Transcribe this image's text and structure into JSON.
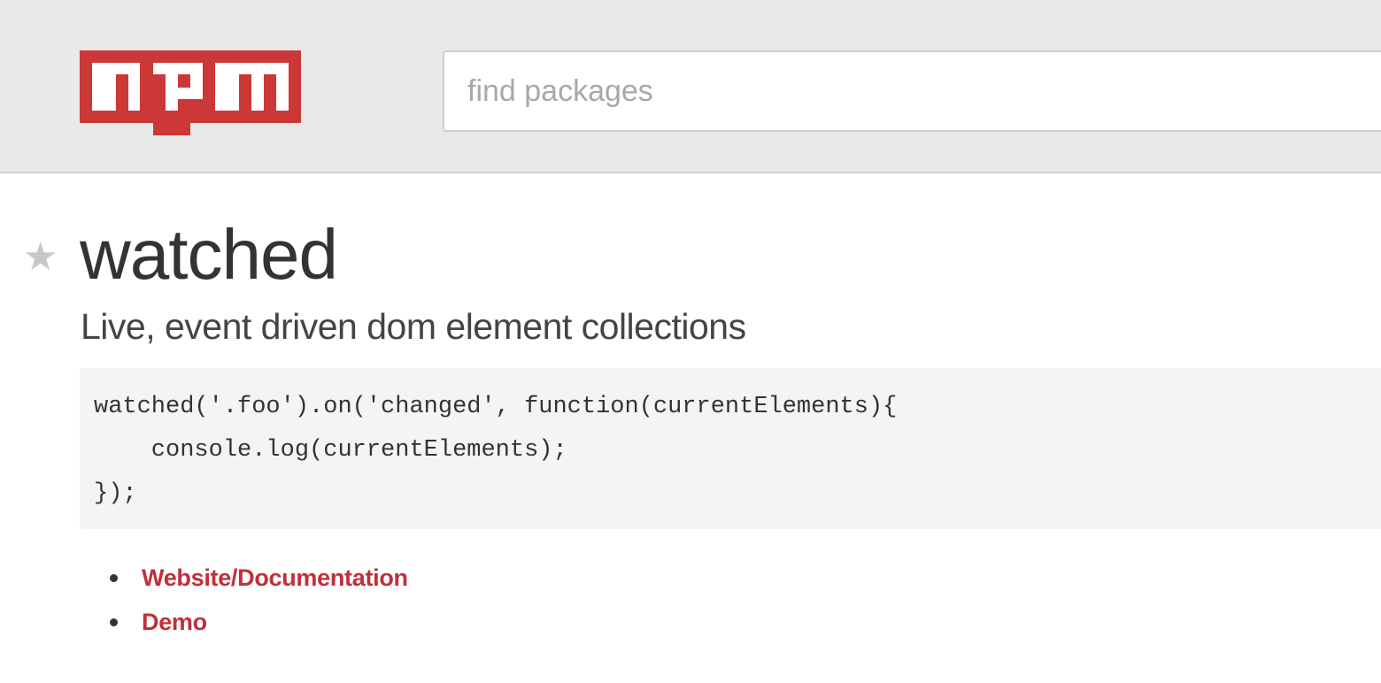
{
  "header": {
    "logo_text": "npm",
    "brand_color": "#cb3837",
    "search_placeholder": "find packages"
  },
  "package": {
    "star_icon": "star-icon",
    "name": "watched",
    "description": "Live, event driven dom element collections"
  },
  "readme": {
    "code_lines": [
      "watched('.foo').on('changed', function(currentElements){",
      "    console.log(currentElements);",
      "});"
    ],
    "links": [
      {
        "label": "Website/Documentation"
      },
      {
        "label": "Demo"
      }
    ]
  },
  "colors": {
    "header_bg": "#e9e9e9",
    "link": "#c12f3a",
    "code_bg": "#f4f4f4"
  }
}
